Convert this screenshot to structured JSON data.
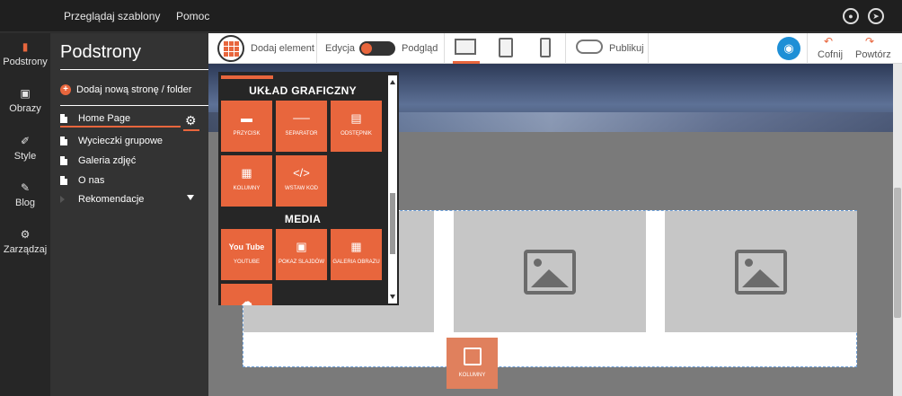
{
  "topbar": {
    "links": [
      "Przeglądaj szablony",
      "Pomoc"
    ],
    "icons": [
      "user-icon",
      "logout-icon"
    ]
  },
  "leftnav": [
    {
      "label": "Podstrony",
      "icon": "page-icon"
    },
    {
      "label": "Obrazy",
      "icon": "image-icon"
    },
    {
      "label": "Style",
      "icon": "brush-icon"
    },
    {
      "label": "Blog",
      "icon": "edit-icon"
    },
    {
      "label": "Zarządzaj",
      "icon": "gear-icon"
    }
  ],
  "sidebar": {
    "title": "Podstrony",
    "add_page": "Dodaj nową stronę / folder",
    "pages": [
      "Home Page",
      "Wycieczki grupowe",
      "Galeria zdjęć",
      "O nas",
      "Rekomendacje"
    ]
  },
  "toolbar": {
    "add_element": "Dodaj element",
    "edit": "Edycja",
    "preview": "Podgląd",
    "publish": "Publikuj",
    "undo": "Cofnij",
    "redo": "Powtórz"
  },
  "panel": {
    "section_layout": "UKŁAD GRAFICZNY",
    "section_media": "MEDIA",
    "layout_tiles": [
      {
        "label": "PRZYCISK",
        "icon": "button-icon"
      },
      {
        "label": "SEPARATOR",
        "icon": "separator-icon"
      },
      {
        "label": "ODSTĘPNIK",
        "icon": "spacer-icon"
      },
      {
        "label": "KOLUMNY",
        "icon": "columns-icon"
      },
      {
        "label": "WSTAW KOD",
        "icon": "code-icon"
      }
    ],
    "media_tiles": [
      {
        "label": "YOUTUBE",
        "icon": "youtube-icon",
        "badge": "You Tube"
      },
      {
        "label": "POKAZ SLAJDÓW",
        "icon": "slideshow-icon"
      },
      {
        "label": "GALERIA OBRAZU",
        "icon": "gallery-icon"
      },
      {
        "label": "",
        "icon": "soundcloud-icon"
      }
    ]
  },
  "drag_tile": {
    "label": "KOLUMNY"
  },
  "colors": {
    "accent": "#e8663d",
    "eye": "#1e8fd6"
  }
}
